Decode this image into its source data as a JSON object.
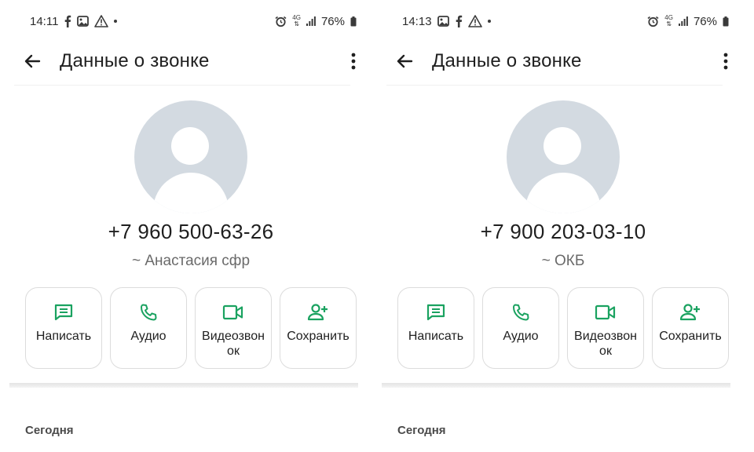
{
  "colors": {
    "accent_green": "#1aa260",
    "avatar_bg": "#d3dae1"
  },
  "panels": [
    {
      "status_bar": {
        "time": "14:11",
        "battery": "76%",
        "network": "4G",
        "icons": [
          "facebook-icon",
          "gallery-icon",
          "warning-icon",
          "dot-icon",
          "alarm-icon",
          "network-icon",
          "signal-icon",
          "battery-icon"
        ]
      },
      "app_bar": {
        "title": "Данные о звонке"
      },
      "contact": {
        "number": "+7 960 500-63-26",
        "name": "~ Анастасия сфр"
      },
      "actions": [
        {
          "line1": "Написать",
          "line2": "",
          "icon": "message-icon"
        },
        {
          "line1": "Аудио",
          "line2": "",
          "icon": "phone-icon"
        },
        {
          "line1": "Видеозвон",
          "line2": "ок",
          "icon": "video-icon"
        },
        {
          "line1": "Сохранить",
          "line2": "",
          "icon": "add-person-icon"
        }
      ],
      "section_label": "Сегодня"
    },
    {
      "status_bar": {
        "time": "14:13",
        "battery": "76%",
        "network": "4G",
        "icons": [
          "gallery-icon",
          "facebook-icon",
          "warning-icon",
          "dot-icon",
          "alarm-icon",
          "network-icon",
          "signal-icon",
          "battery-icon"
        ]
      },
      "app_bar": {
        "title": "Данные о звонке"
      },
      "contact": {
        "number": "+7 900 203-03-10",
        "name": "~ ОКБ"
      },
      "actions": [
        {
          "line1": "Написать",
          "line2": "",
          "icon": "message-icon"
        },
        {
          "line1": "Аудио",
          "line2": "",
          "icon": "phone-icon"
        },
        {
          "line1": "Видеозвон",
          "line2": "ок",
          "icon": "video-icon"
        },
        {
          "line1": "Сохранить",
          "line2": "",
          "icon": "add-person-icon"
        }
      ],
      "section_label": "Сегодня"
    }
  ]
}
